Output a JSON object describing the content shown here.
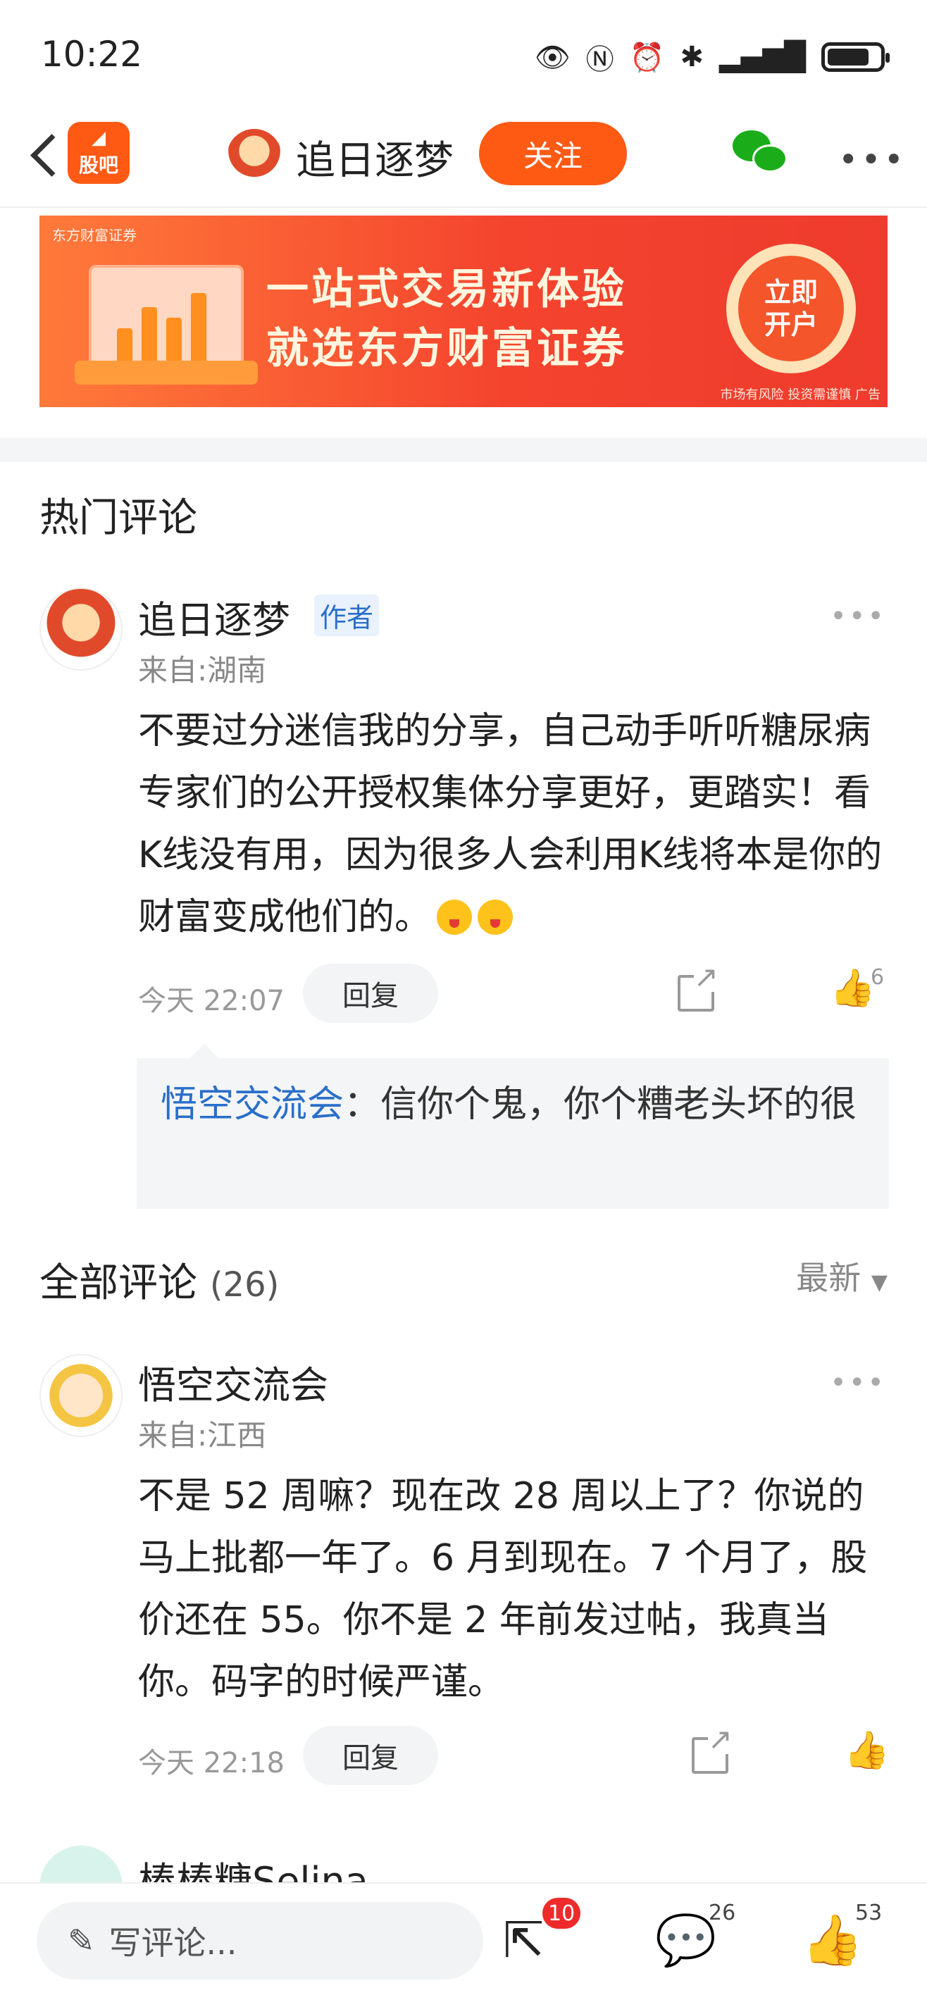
{
  "status_bar": {
    "time": "10:22",
    "icons": [
      "eye-icon",
      "nfc-icon",
      "alarm-icon",
      "bluetooth-icon",
      "signal-icon",
      "battery-icon"
    ],
    "battery_level": 0.8
  },
  "header": {
    "app_logo_text": "股吧",
    "author_name": "追日逐梦",
    "follow_label": "关注",
    "accent_color": "#ff5a14"
  },
  "banner": {
    "brand": "东方财富证券",
    "line1": "一站式交易新体验",
    "line2": "就选东方财富证券",
    "cta": "立即开户",
    "disclaimer": "市场有风险 投资需谨慎 广告"
  },
  "hot_comments": {
    "title": "热门评论",
    "comment": {
      "name": "追日逐梦",
      "author_tag": "作者",
      "location": "来自:湖南",
      "text": "不要过分迷信我的分享，自己动手听听糖尿病专家们的公开授权集体分享更好，更踏实！看K线没有用，因为很多人会利用K线将本是你的财富变成他们的。",
      "time": "今天 22:07",
      "reply_label": "回复",
      "likes": "6",
      "reply": {
        "who": "悟空交流会",
        "text": "：信你个鬼，你个糟老头坏的很"
      }
    }
  },
  "all_comments": {
    "title": "全部评论",
    "count": "(26)",
    "sort_label": "最新",
    "items": [
      {
        "name": "悟空交流会",
        "location": "来自:江西",
        "text": "不是 52 周嘛？现在改 28 周以上了？你说的马上批都一年了。6 月到现在。7 个月了，股价还在 55。你不是 2 年前发过帖，我真当你。码字的时候严谨。",
        "time": "今天 22:18",
        "reply_label": "回复"
      },
      {
        "name": "棒棒糖Selina"
      }
    ]
  },
  "bottom_bar": {
    "write_placeholder": "写评论...",
    "share_badge": "10",
    "comment_count": "26",
    "like_count": "53"
  }
}
